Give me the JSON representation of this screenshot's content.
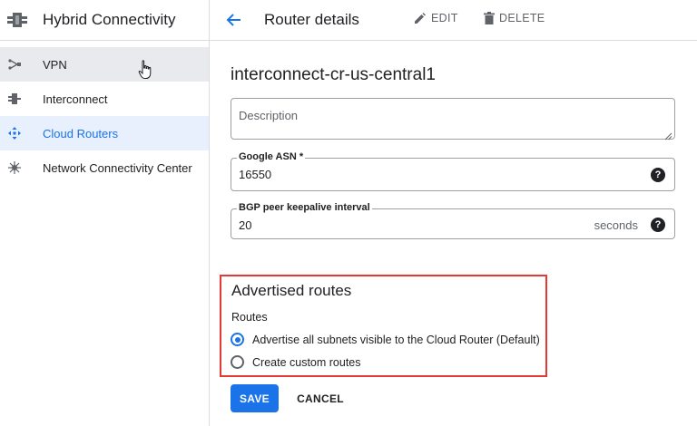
{
  "app": {
    "title": "Hybrid Connectivity",
    "icon": "hybrid-connectivity-icon"
  },
  "sidebar": {
    "items": [
      {
        "label": "VPN",
        "icon": "vpn-icon",
        "state": "hover"
      },
      {
        "label": "Interconnect",
        "icon": "interconnect-icon",
        "state": "normal"
      },
      {
        "label": "Cloud Routers",
        "icon": "cloud-router-icon",
        "state": "active"
      },
      {
        "label": "Network Connectivity Center",
        "icon": "network-connectivity-center-icon",
        "state": "normal"
      }
    ]
  },
  "header": {
    "title": "Router details",
    "edit_label": "EDIT",
    "delete_label": "DELETE"
  },
  "router": {
    "name": "interconnect-cr-us-central1"
  },
  "form": {
    "description": {
      "placeholder": "Description",
      "value": ""
    },
    "asn": {
      "label": "Google ASN *",
      "value": "16550"
    },
    "bgp": {
      "label": "BGP peer keepalive interval",
      "value": "20",
      "suffix": "seconds"
    }
  },
  "advertised_routes": {
    "title": "Advertised routes",
    "subtitle": "Routes",
    "options": [
      {
        "label": "Advertise all subnets visible to the Cloud Router (Default)",
        "selected": true
      },
      {
        "label": "Create custom routes",
        "selected": false
      }
    ]
  },
  "buttons": {
    "save": "SAVE",
    "cancel": "CANCEL"
  },
  "colors": {
    "accent": "#1a73e8",
    "highlight_border": "#e53935",
    "active_nav_bg": "#e8f0fe",
    "hover_nav_bg": "#e8eaed"
  }
}
